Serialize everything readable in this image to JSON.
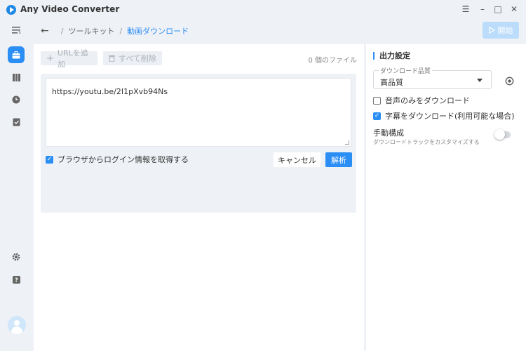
{
  "app": {
    "title": "Any Video Converter"
  },
  "window": {
    "menu_glyph": "☰",
    "minimize_glyph": "–",
    "maximize_glyph": "□",
    "close_glyph": "✕"
  },
  "breadcrumb": {
    "back_glyph": "←",
    "items": [
      "ツールキット",
      "動画ダウンロード"
    ],
    "separator": "/"
  },
  "header": {
    "start_label": "開始"
  },
  "toolbar": {
    "add_url_label": "URLを追加",
    "add_url_glyph": "+",
    "delete_all_label": "すべて削除",
    "file_count": "0 個のファイル"
  },
  "url_input": {
    "value": "https://youtu.be/2I1pXvb94Ns"
  },
  "actions": {
    "login_checkbox_label": "ブラウザからログイン情報を取得する",
    "login_checked": true,
    "cancel_label": "キャンセル",
    "parse_label": "解析"
  },
  "output": {
    "title": "出力設定",
    "quality_label": "ダウンロード品質",
    "quality_value": "高品質",
    "audio_only_label": "音声のみをダウンロード",
    "audio_only_checked": false,
    "subtitles_label": "字幕をダウンロード(利用可能な場合)",
    "subtitles_checked": true,
    "manual_label": "手動構成",
    "manual_desc": "ダウンロードトラックをカスタマイズする",
    "manual_on": false
  },
  "colors": {
    "accent": "#2b8ef5",
    "accent_light": "#bcdcfb",
    "background": "#eef1f6"
  },
  "icons": [
    "app-logo-icon",
    "menu-icon",
    "minimize-icon",
    "maximize-icon",
    "close-icon",
    "collapse-sidebar-icon",
    "toolkit-icon",
    "library-icon",
    "history-icon",
    "tasks-icon",
    "settings-icon",
    "help-icon",
    "avatar-icon",
    "back-arrow-icon",
    "start-icon",
    "plus-icon",
    "trash-icon",
    "dropdown-caret-icon",
    "output-settings-icon"
  ]
}
